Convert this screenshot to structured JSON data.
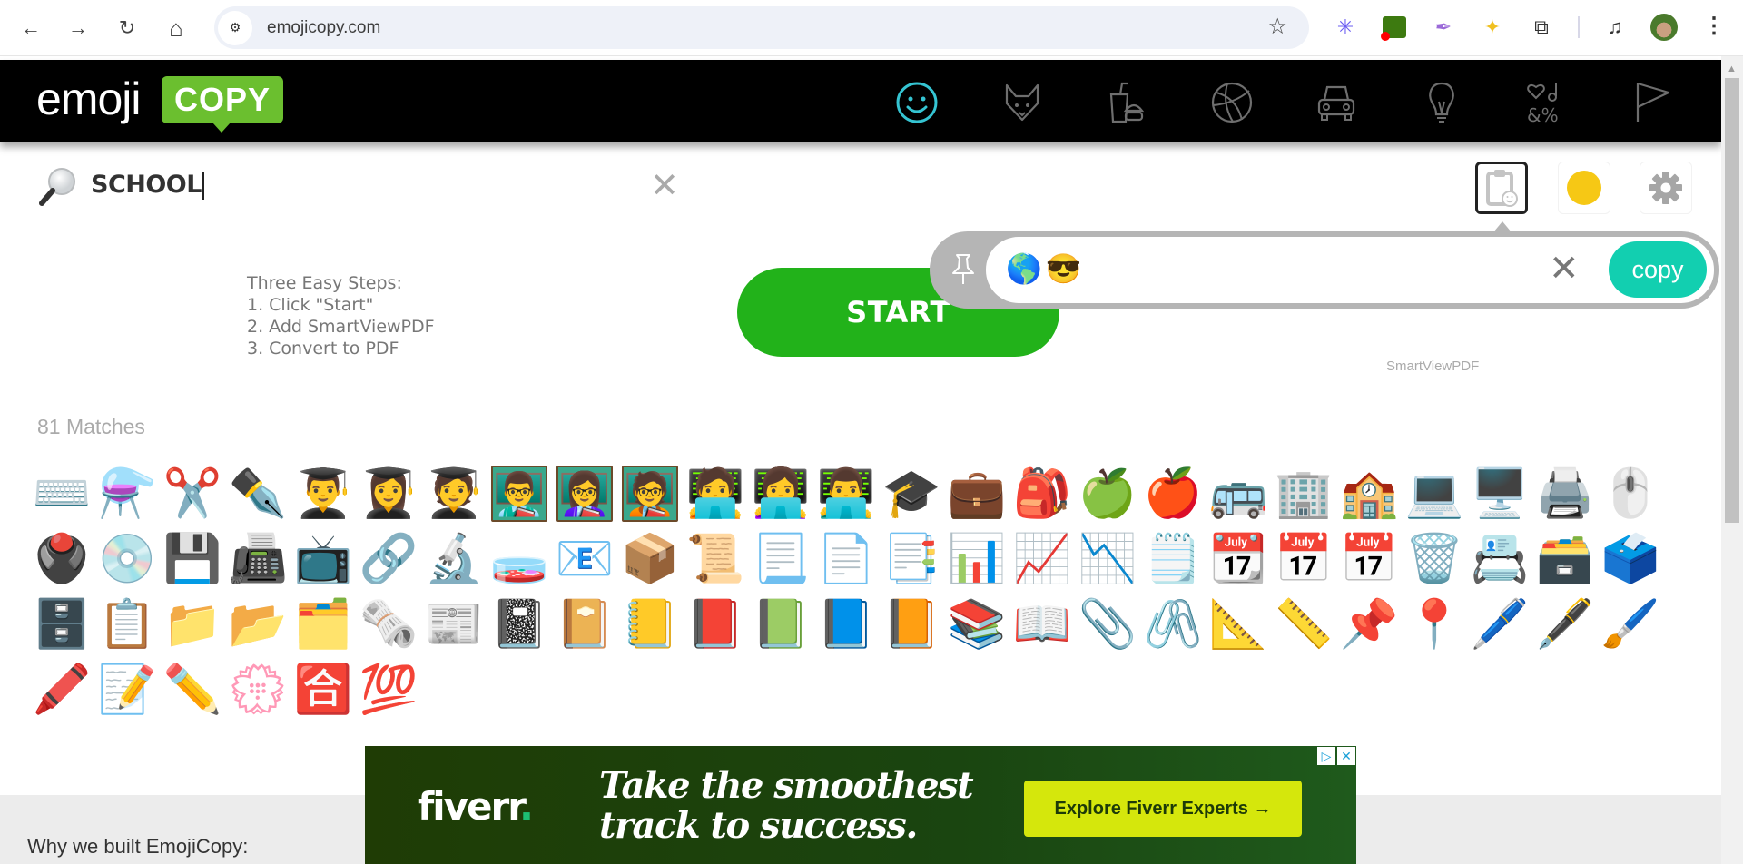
{
  "browser": {
    "url": "emojicopy.com",
    "nav": {
      "back": "←",
      "forward": "→",
      "reload": "↻",
      "home": "⌂"
    },
    "site_info_icon": "⚙",
    "bookmark_icon": "☆",
    "extensions": [
      {
        "name": "asterisk-extension",
        "glyph": "✳",
        "color": "#6a5cf2"
      },
      {
        "name": "recorder-extension",
        "glyph": "■",
        "color": "#3d7a10"
      },
      {
        "name": "quill-extension",
        "glyph": "✒",
        "color": "#9b6ad8"
      },
      {
        "name": "puzzle-yellow-extension",
        "glyph": "✦",
        "color": "#f0c020"
      },
      {
        "name": "extensions-menu",
        "glyph": "⧉",
        "color": "#333333"
      },
      {
        "name": "media-control",
        "glyph": "♫",
        "color": "#333333"
      }
    ],
    "menu_glyph": "⋮"
  },
  "site": {
    "logo": {
      "word": "emoji",
      "badge": "COPY"
    },
    "categories": [
      {
        "name": "smileys",
        "active": true
      },
      {
        "name": "animals",
        "active": false
      },
      {
        "name": "food",
        "active": false
      },
      {
        "name": "activities",
        "active": false
      },
      {
        "name": "travel",
        "active": false
      },
      {
        "name": "objects",
        "active": false
      },
      {
        "name": "symbols",
        "active": false
      },
      {
        "name": "flags",
        "active": false
      }
    ],
    "colors": {
      "accent": "#6bbf2f",
      "active_category": "#35c4d2",
      "inactive_category": "#6e6e6e",
      "copy_button": "#12cfb0",
      "start_button": "#22b21a",
      "skin_tone": "#f6c815"
    }
  },
  "search": {
    "value": "SCHOOL",
    "clear_glyph": "✕"
  },
  "toolbar": {
    "clipboard_label": "clipboard",
    "skin_tone_label": "skin tone",
    "settings_label": "settings"
  },
  "clipboard": {
    "contents": [
      "🌎",
      "😎"
    ],
    "clear_glyph": "✕",
    "copy_label": "copy"
  },
  "promo": {
    "steps": [
      "Three Easy Steps:",
      "1. Click \"Start\"",
      "2. Add SmartViewPDF",
      "3. Convert to PDF"
    ],
    "start_label": "START",
    "sponsor": "SmartViewPDF"
  },
  "results": {
    "count_label": "81 Matches",
    "emojis": [
      "⌨️",
      "⚗️",
      "✂️",
      "✒️",
      "👨‍🎓",
      "👩‍🎓",
      "🧑‍🎓",
      "👨‍🏫",
      "👩‍🏫",
      "🧑‍🏫",
      "🧑‍💻",
      "👩‍💻",
      "👨‍💻",
      "🎓",
      "💼",
      "🎒",
      "🍏",
      "🍎",
      "🚌",
      "🏢",
      "🏫",
      "💻",
      "🖥️",
      "🖨️",
      "🖱️",
      "🖲️",
      "💿",
      "💾",
      "📠",
      "📺",
      "🔗",
      "🔬",
      "🧫",
      "📧",
      "📦",
      "📜",
      "📃",
      "📄",
      "📑",
      "📊",
      "📈",
      "📉",
      "🗒️",
      "📆",
      "📅",
      "📅",
      "🗑️",
      "📇",
      "🗃️",
      "🗳️",
      "🗄️",
      "📋",
      "📁",
      "📂",
      "🗂️",
      "🗞️",
      "📰",
      "📓",
      "📔",
      "📒",
      "📕",
      "📗",
      "📘",
      "📙",
      "📚",
      "📖",
      "📎",
      "🖇️",
      "📐",
      "📏",
      "📌",
      "📍",
      "🖊️",
      "🖋️",
      "🖌️",
      "🖍️",
      "📝",
      "✏️",
      "💮",
      "🈴",
      "💯"
    ]
  },
  "footer": {
    "why_heading": "Why we built EmojiCopy:"
  },
  "ad": {
    "brand": "fiverr",
    "brand_dot": ".",
    "headline_line1": "Take the smoothest",
    "headline_line2": "track to success.",
    "cta": "Explore Fiverr Experts →",
    "adchoices_glyph": "▷",
    "close_glyph": "✕"
  }
}
